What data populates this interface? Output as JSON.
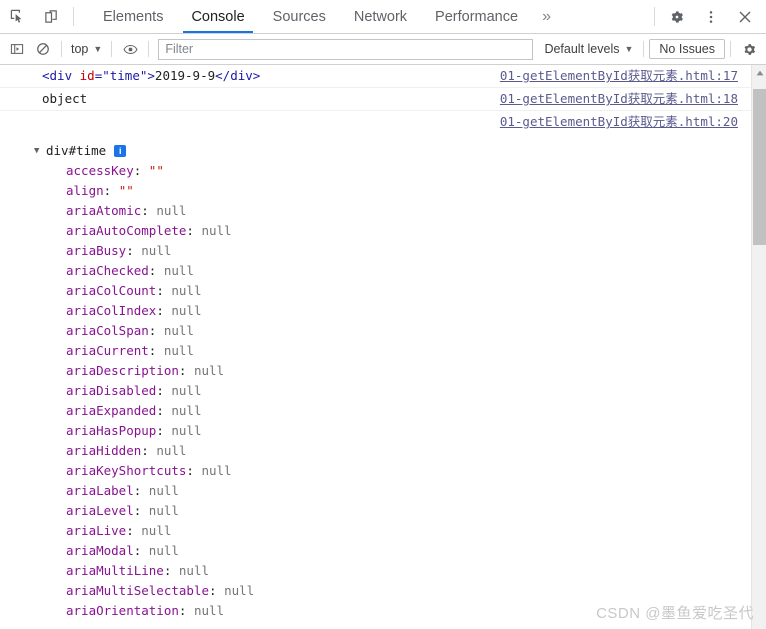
{
  "devtools": {
    "tabbar": {
      "inspect_icon": "inspect-element-icon",
      "device_icon": "device-toolbar-icon",
      "tabs": [
        {
          "label": "Elements",
          "active": false
        },
        {
          "label": "Console",
          "active": true
        },
        {
          "label": "Sources",
          "active": false
        },
        {
          "label": "Network",
          "active": false
        },
        {
          "label": "Performance",
          "active": false
        }
      ],
      "more_tabs": "»",
      "settings_icon": "gear-icon",
      "menu_icon": "three-dot-menu-icon",
      "close_icon": "close-icon"
    },
    "filterbar": {
      "sidebar_icon": "console-sidebar-icon",
      "clear_icon": "clear-console-icon",
      "context_label": "top",
      "context_caret": "▼",
      "eye_icon": "live-expression-eye-icon",
      "filter_placeholder": "Filter",
      "filter_value": "",
      "levels_label": "Default levels",
      "levels_caret": "▼",
      "issues_label": "No Issues",
      "settings_icon": "console-settings-gear-icon"
    },
    "messages": [
      {
        "kind": "html",
        "tag_open": "<div ",
        "attr_name": "id",
        "attr_eq": "=",
        "attr_value": "\"time\"",
        "tag_close_bracket": ">",
        "inner_text": "2019-9-9",
        "tag_end": "</div>",
        "source_link": "01-getElementById获取元素.html:17"
      },
      {
        "kind": "plain",
        "text": "object",
        "source_link": "01-getElementById获取元素.html:18"
      },
      {
        "kind": "empty",
        "text": "",
        "source_link": "01-getElementById获取元素.html:20"
      }
    ],
    "object_tree": {
      "disclosure": "▼",
      "title": "div#time",
      "info_badge": "i",
      "properties": [
        {
          "name": "accessKey",
          "value": "\"\"",
          "type": "string"
        },
        {
          "name": "align",
          "value": "\"\"",
          "type": "string"
        },
        {
          "name": "ariaAtomic",
          "value": "null",
          "type": "null"
        },
        {
          "name": "ariaAutoComplete",
          "value": "null",
          "type": "null"
        },
        {
          "name": "ariaBusy",
          "value": "null",
          "type": "null"
        },
        {
          "name": "ariaChecked",
          "value": "null",
          "type": "null"
        },
        {
          "name": "ariaColCount",
          "value": "null",
          "type": "null"
        },
        {
          "name": "ariaColIndex",
          "value": "null",
          "type": "null"
        },
        {
          "name": "ariaColSpan",
          "value": "null",
          "type": "null"
        },
        {
          "name": "ariaCurrent",
          "value": "null",
          "type": "null"
        },
        {
          "name": "ariaDescription",
          "value": "null",
          "type": "null"
        },
        {
          "name": "ariaDisabled",
          "value": "null",
          "type": "null"
        },
        {
          "name": "ariaExpanded",
          "value": "null",
          "type": "null"
        },
        {
          "name": "ariaHasPopup",
          "value": "null",
          "type": "null"
        },
        {
          "name": "ariaHidden",
          "value": "null",
          "type": "null"
        },
        {
          "name": "ariaKeyShortcuts",
          "value": "null",
          "type": "null"
        },
        {
          "name": "ariaLabel",
          "value": "null",
          "type": "null"
        },
        {
          "name": "ariaLevel",
          "value": "null",
          "type": "null"
        },
        {
          "name": "ariaLive",
          "value": "null",
          "type": "null"
        },
        {
          "name": "ariaModal",
          "value": "null",
          "type": "null"
        },
        {
          "name": "ariaMultiLine",
          "value": "null",
          "type": "null"
        },
        {
          "name": "ariaMultiSelectable",
          "value": "null",
          "type": "null"
        },
        {
          "name": "ariaOrientation",
          "value": "null",
          "type": "null"
        }
      ]
    },
    "scrollbar": {
      "up_arrow": "▲"
    },
    "watermark": "CSDN @墨鱼爱吃圣代",
    "colors": {
      "accent": "#1a73e8",
      "property_name": "#881391",
      "null_value": "#767676",
      "string_value": "#c41a16",
      "link": "#5a5a8f",
      "tag": "#1a1aa6",
      "attribute": "#c80000"
    }
  }
}
